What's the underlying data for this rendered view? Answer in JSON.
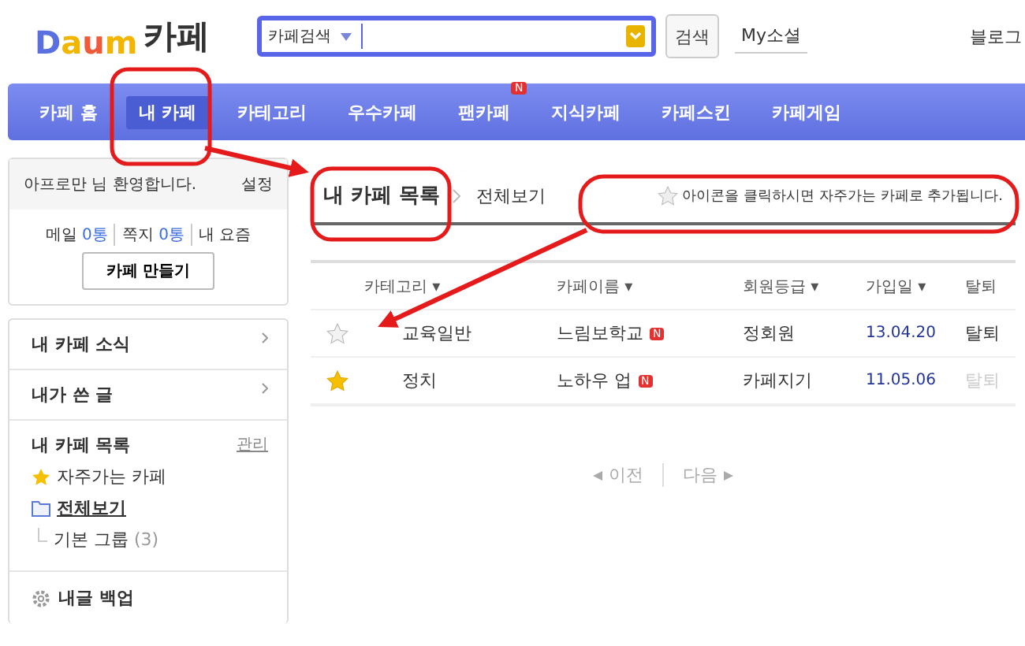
{
  "header": {
    "logo_letters": [
      "D",
      "a",
      "u",
      "m"
    ],
    "logo_title": "카페",
    "search": {
      "scope": "카페검색"
    },
    "search_button": "검색",
    "my_social": "My소셜",
    "blog_link": "블로그"
  },
  "nav": [
    {
      "label": "카페 홈",
      "selected": false
    },
    {
      "label": "내 카페",
      "selected": true
    },
    {
      "label": "카테고리",
      "selected": false
    },
    {
      "label": "우수카페",
      "selected": false
    },
    {
      "label": "팬카페",
      "selected": false,
      "badge": "N"
    },
    {
      "label": "지식카페",
      "selected": false
    },
    {
      "label": "카페스킨",
      "selected": false
    },
    {
      "label": "카페게임",
      "selected": false
    }
  ],
  "sidebar": {
    "welcome": "아프로만 님 환영합니다.",
    "settings": "설정",
    "stats": [
      {
        "label": "메일",
        "count": "0통"
      },
      {
        "label": "쪽지",
        "count": "0통"
      }
    ],
    "my_news": "내 요즘",
    "create_button": "카페 만들기",
    "menu": [
      "내 카페 소식",
      "내가 쓴 글"
    ],
    "cafe_list": {
      "title": "내 카페 목록",
      "manage": "관리",
      "items": [
        {
          "label": "자주가는 카페",
          "kind": "favorites",
          "selected": false
        },
        {
          "label": "전체보기",
          "kind": "folder",
          "selected": true,
          "children": [
            {
              "label": "기본 그룹",
              "count": "(3)"
            }
          ]
        }
      ]
    },
    "backup": "내글 백업"
  },
  "main": {
    "title": "내 카페 목록",
    "breadcrumb": "전체보기",
    "hint": "아이콘을 클릭하시면 자주가는 카페로 추가됩니다.",
    "columns": [
      "카테고리 ▾",
      "카페이름 ▾",
      "회원등급 ▾",
      "가입일 ▾",
      "탈퇴"
    ],
    "rows": [
      {
        "favorite": false,
        "category": "교육일반",
        "name": "느림보학교",
        "badge": "N",
        "grade": "정회원",
        "joined": "13.04.20",
        "leave": "탈퇴",
        "leave_disabled": false
      },
      {
        "favorite": true,
        "category": "정치",
        "name": "노하우 업",
        "badge": "N",
        "grade": "카페지기",
        "joined": "11.05.06",
        "leave": "탈퇴",
        "leave_disabled": true
      }
    ],
    "pagination": {
      "prev": "이전",
      "next": "다음"
    }
  }
}
